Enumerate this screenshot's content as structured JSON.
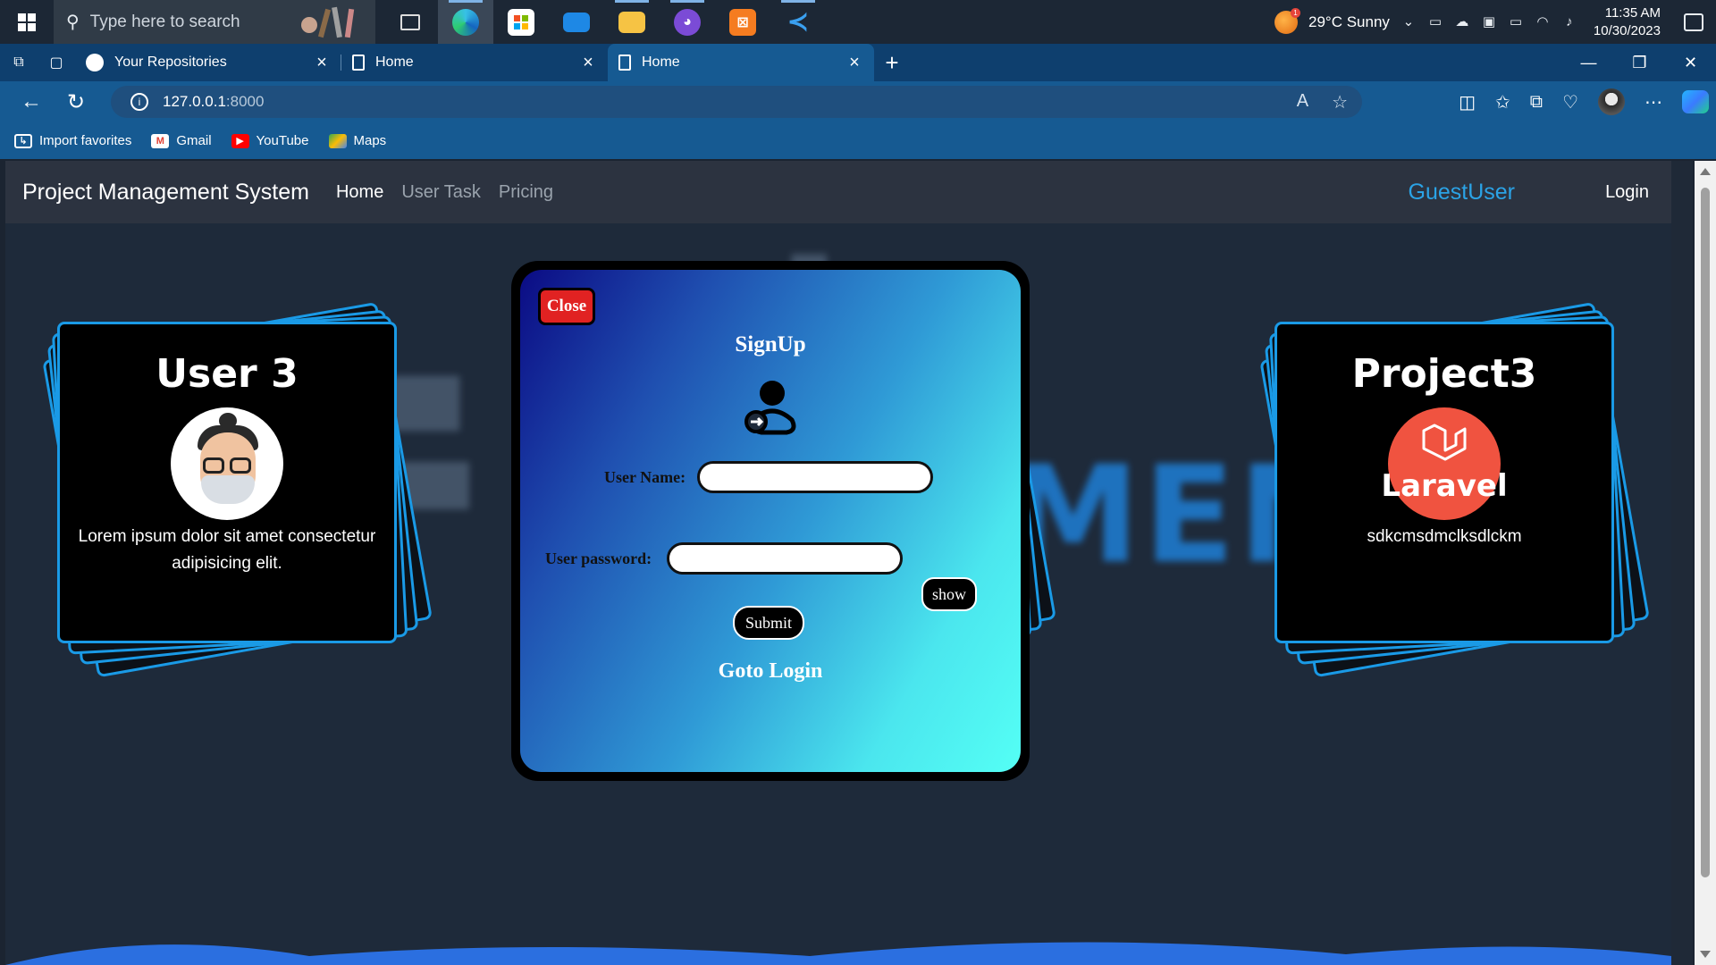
{
  "taskbar": {
    "search_placeholder": "Type here to search",
    "weather": "29°C  Sunny",
    "time": "11:35 AM",
    "date": "10/30/2023",
    "apps": [
      "task-view",
      "edge",
      "store",
      "mail",
      "file-explorer",
      "github-desktop",
      "xampp",
      "vscode"
    ]
  },
  "browser": {
    "tabs": [
      {
        "label": "Your Repositories",
        "icon": "github-icon"
      },
      {
        "label": "Home",
        "icon": "page-icon"
      },
      {
        "label": "Home",
        "icon": "page-icon"
      }
    ],
    "url_host": "127.0.0.1",
    "url_port": ":8000",
    "favorites": [
      {
        "label": "Import favorites"
      },
      {
        "label": "Gmail"
      },
      {
        "label": "YouTube"
      },
      {
        "label": "Maps"
      }
    ]
  },
  "navbar": {
    "brand": "Project Management System",
    "links": [
      "Home",
      "User Task",
      "Pricing"
    ],
    "user": "GuestUser",
    "login": "Login"
  },
  "cards": {
    "left": {
      "title": "User 3",
      "text": "Lorem ipsum dolor sit amet consectetur adipisicing elit."
    },
    "right": {
      "title": "Project3",
      "logo_text": "Laravel",
      "text": "sdkcmsdmclksdlckm"
    }
  },
  "modal": {
    "close": "Close",
    "title": "SignUp",
    "username_label": "User Name:",
    "username_value": "",
    "password_label": "User password:",
    "password_value": "",
    "show": "show",
    "submit": "Submit",
    "goto_login": "Goto Login"
  },
  "colors": {
    "accent": "#1a9ae6",
    "guest_user": "#2ba3e6",
    "close_button": "#e12222"
  }
}
